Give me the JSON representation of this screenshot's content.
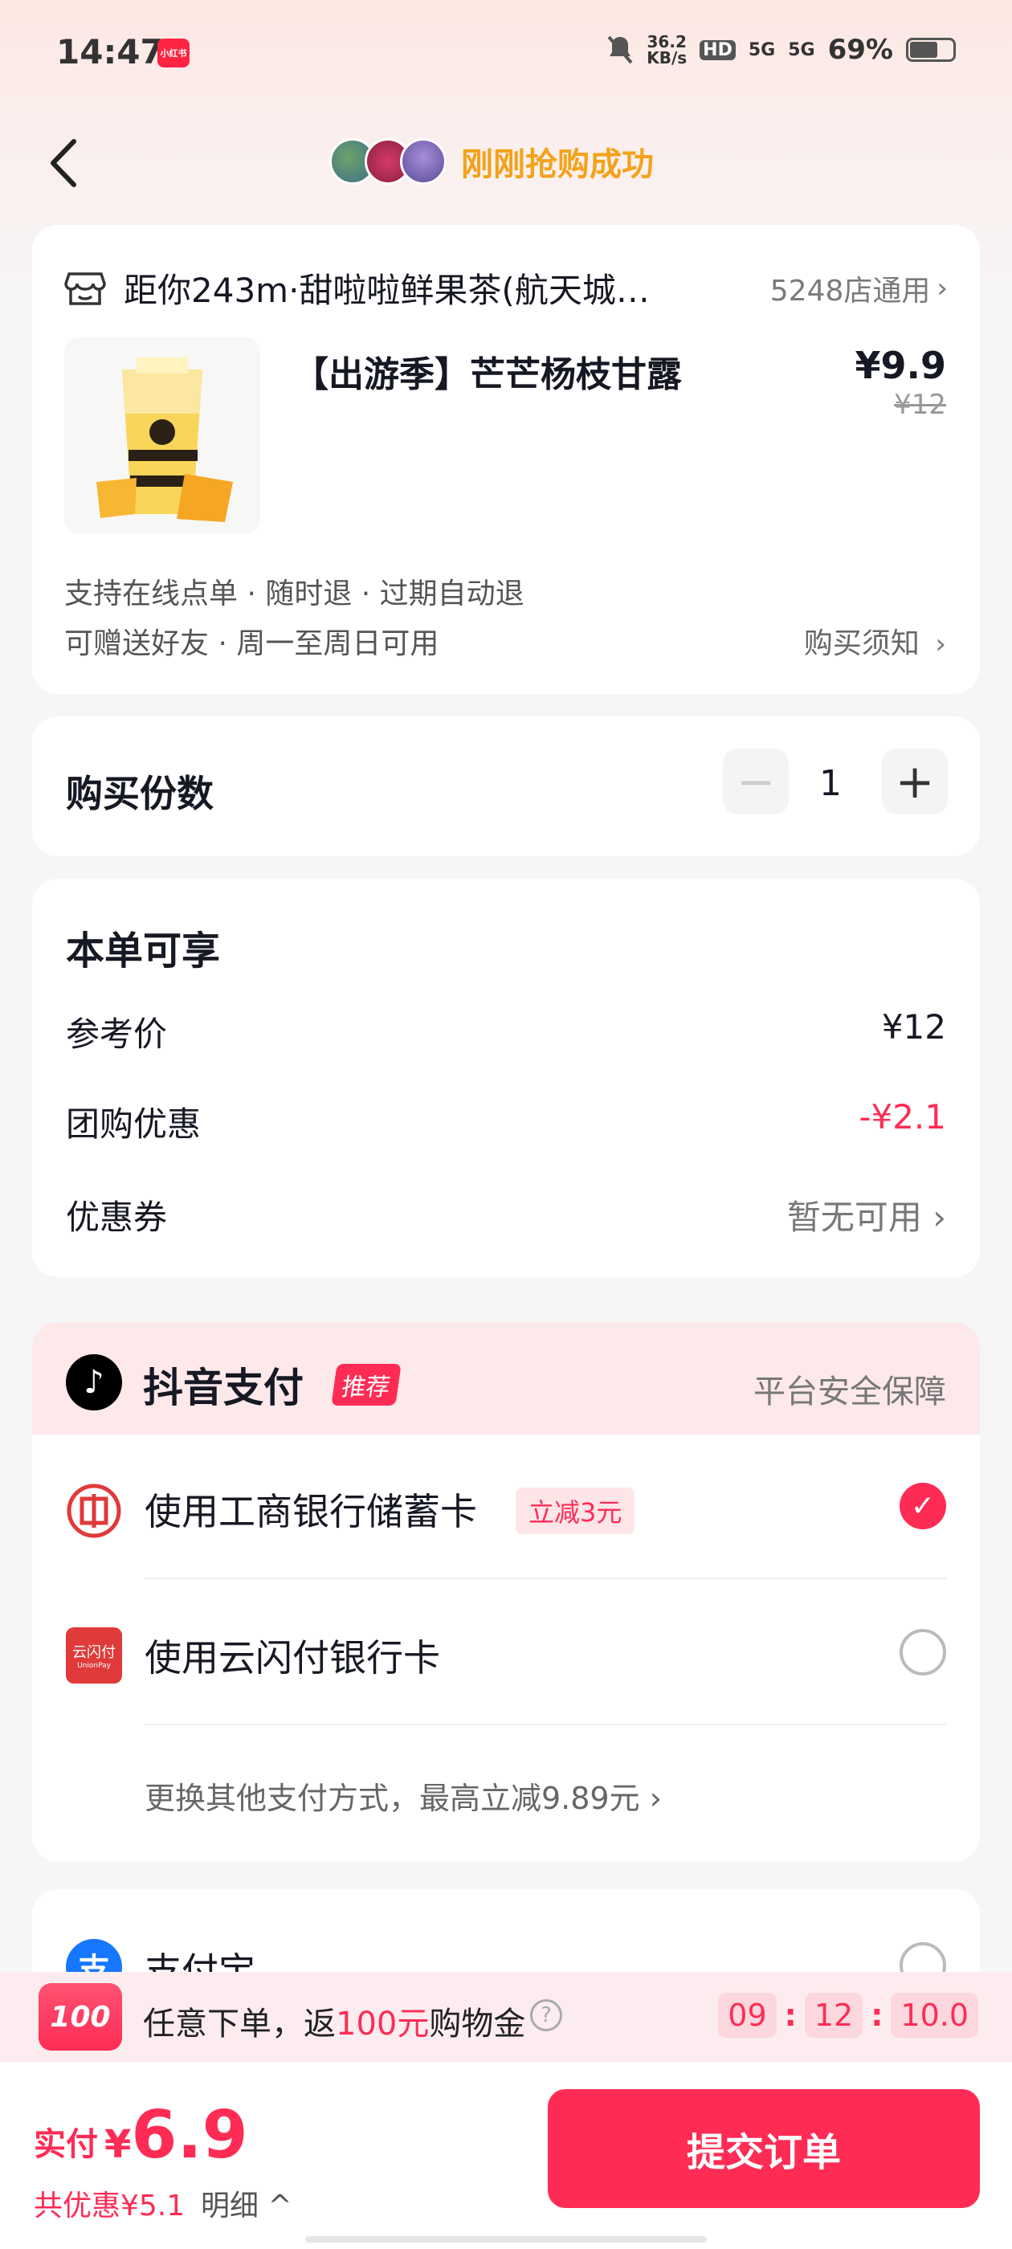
{
  "status_bar": {
    "time": "14:47",
    "app_badge": "小红书",
    "net_speed_value": "36.2",
    "net_speed_unit": "KB/s",
    "hd": "HD",
    "sig1": "5G",
    "sig2": "5G",
    "battery": "69%"
  },
  "nav": {
    "title": "刚刚抢购成功"
  },
  "store": {
    "name": "距你243m·甜啦啦鲜果茶(航天城…",
    "count": "5248店通用"
  },
  "product": {
    "title": "【出游季】芒芒杨枝甘露",
    "price": "¥9.9",
    "old_price": "¥12",
    "tags_line1": "支持在线点单 · 随时退 · 过期自动退",
    "tags_line2": "可赠送好友 · 周一至周日可用",
    "notice": "购买须知"
  },
  "quantity": {
    "label": "购买份数",
    "value": "1"
  },
  "discounts": {
    "title": "本单可享",
    "ref_label": "参考价",
    "ref_value": "¥12",
    "group_label": "团购优惠",
    "group_value": "-¥2.1",
    "coupon_label": "优惠券",
    "coupon_value": "暂无可用"
  },
  "payment": {
    "title": "抖音支付",
    "badge": "推荐",
    "safe": "平台安全保障",
    "icbc_label": "使用工商银行储蓄卡",
    "icbc_tag": "立减3元",
    "unionpay_label": "使用云闪付银行卡",
    "unionpay_icon_text": "云闪付",
    "unionpay_icon_sub": "UnionPay",
    "more": "更换其他支付方式，最高立减9.89元",
    "alipay_label": "支付宝",
    "alipay_icon": "支"
  },
  "promo": {
    "badge": "100",
    "text_pre": "任意下单，返",
    "text_hl": "100元",
    "text_post": "购物金",
    "help": "?",
    "timer_h": "09",
    "timer_m": "12",
    "timer_s": "10.0",
    "sep": ":"
  },
  "bottom": {
    "pay_label": "实付",
    "currency": "¥",
    "amount": "6.9",
    "saved": "共优惠¥5.1",
    "detail": "明细 ^",
    "submit": "提交订单"
  },
  "colors": {
    "accent": "#fe2c55",
    "nav_title": "#f4a21a"
  }
}
